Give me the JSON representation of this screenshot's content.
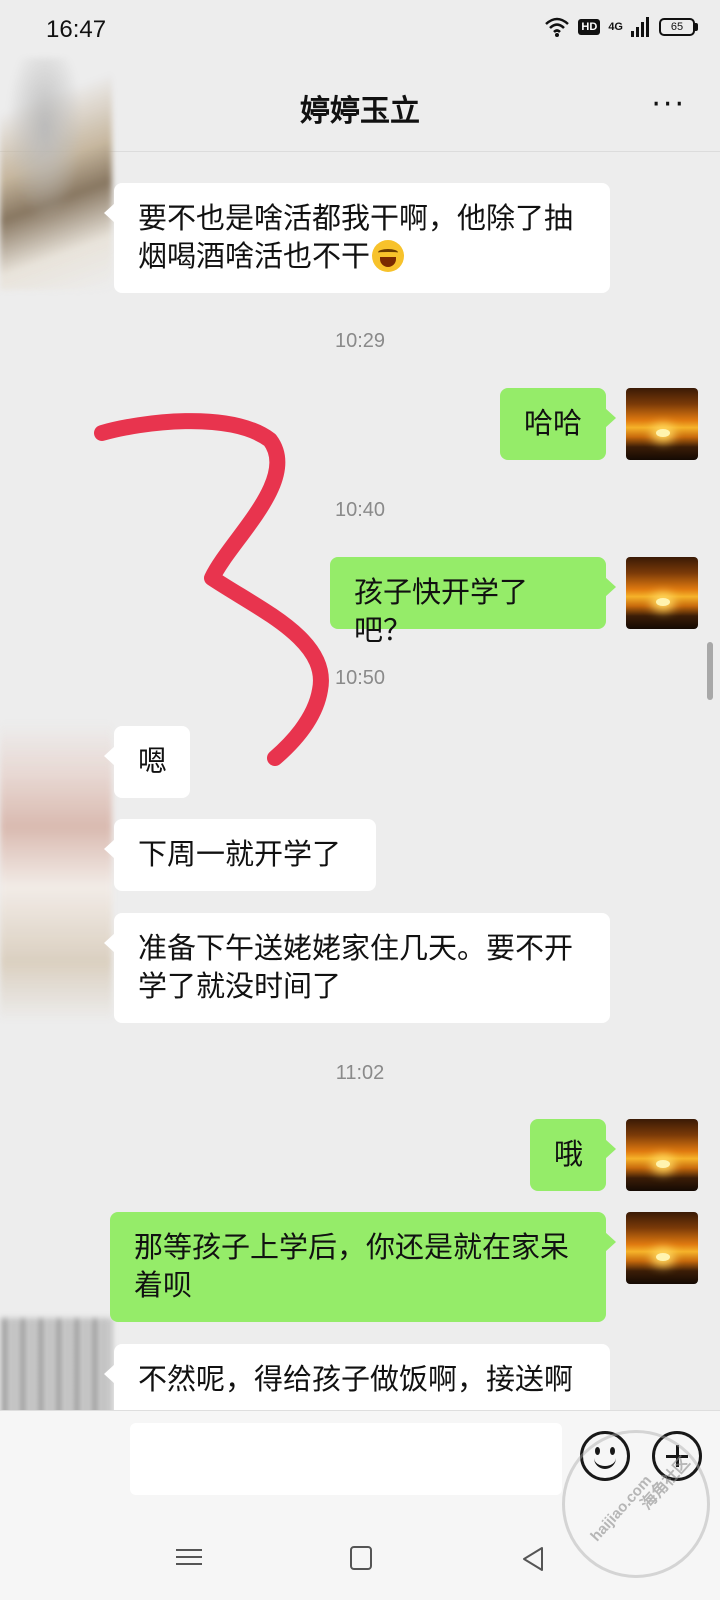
{
  "status_bar": {
    "time": "16:47",
    "hd_label": "HD",
    "network_label": "4G",
    "battery": "65"
  },
  "header": {
    "title": "婷婷玉立",
    "more_label": "···"
  },
  "messages": [
    {
      "side": "left",
      "text": "要不也是啥活都我干啊，他除了抽",
      "text2": "烟喝酒啥活也不干",
      "emoji": "laughing-face-icon"
    },
    {
      "type": "time",
      "text": "10:29"
    },
    {
      "side": "right",
      "text": "哈哈"
    },
    {
      "type": "time",
      "text": "10:40"
    },
    {
      "side": "right",
      "text": "孩子快开学了吧？"
    },
    {
      "type": "time",
      "text": "10:50"
    },
    {
      "side": "left",
      "text": "嗯"
    },
    {
      "side": "left",
      "text": "下周一就开学了"
    },
    {
      "side": "left",
      "text": "准备下午送姥姥家住几天。要不开",
      "text2": "学了就没时间了"
    },
    {
      "type": "time",
      "text": "11:02"
    },
    {
      "side": "right",
      "text": "哦"
    },
    {
      "side": "right",
      "text": "那等孩子上学后，你还是就在家呆",
      "text2": "着呗"
    },
    {
      "side": "left",
      "text": "不然呢，得给孩子做饭啊，接送啊"
    }
  ],
  "input_bar": {
    "placeholder": "",
    "emoji_button_icon": "smiley-icon",
    "plus_button_icon": "plus-icon"
  },
  "nav_bar": {
    "icons": [
      "menu-icon",
      "home-icon",
      "back-icon"
    ]
  },
  "watermark": {
    "text_cn": "海角社区",
    "text_url": "haijiao.com"
  },
  "colors": {
    "background": "#ededed",
    "bubble_left": "#ffffff",
    "bubble_right": "#95ec69",
    "annotation_stroke": "#e8344e"
  }
}
